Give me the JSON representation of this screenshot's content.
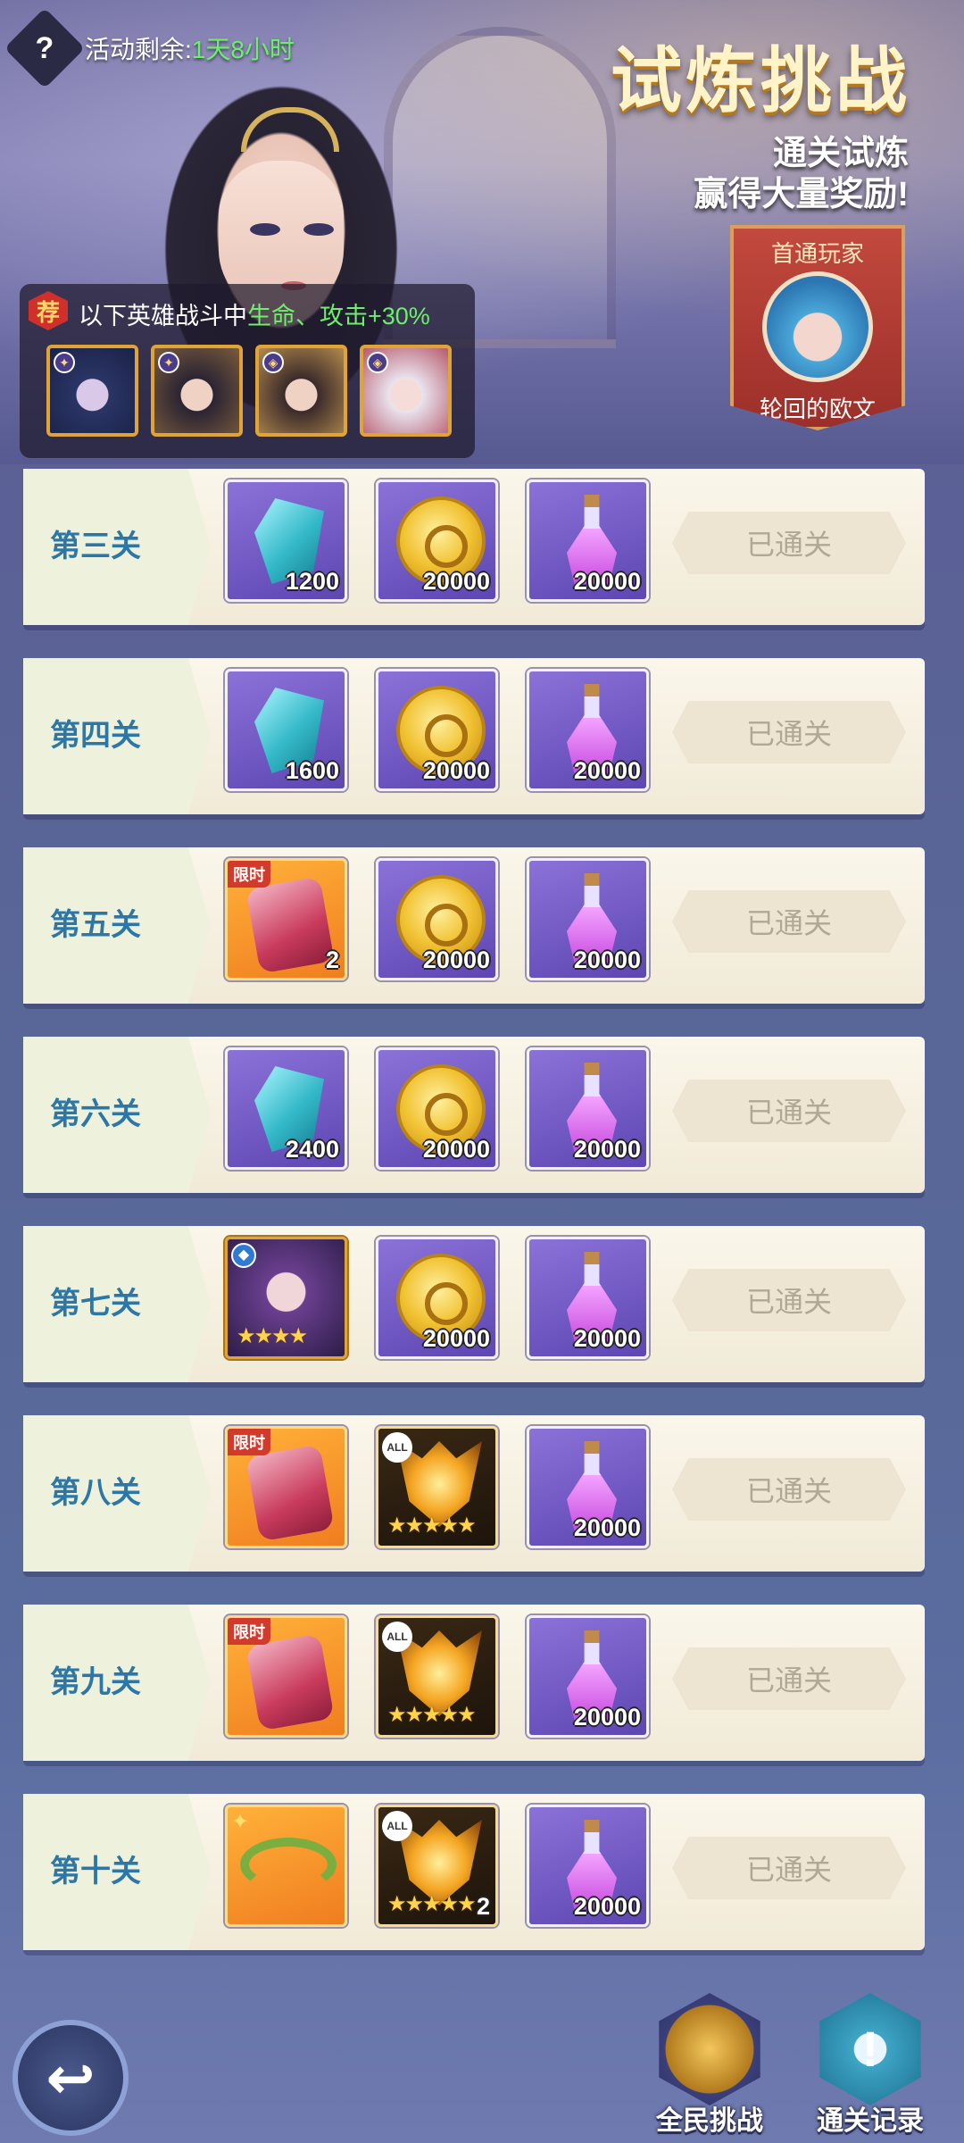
{
  "header": {
    "help_icon": "help-icon",
    "timer_label": "活动剩余:",
    "timer_value": "1天8小时",
    "title": "试炼挑战",
    "subtitle_line1": "通关试炼",
    "subtitle_line2": "赢得大量奖励!",
    "colors": {
      "title": "#fff3c8",
      "highlight": "#6cf06a"
    }
  },
  "first_clear": {
    "title": "首通玩家",
    "player_name": "轮回的欧文"
  },
  "bonus": {
    "tag": "荐",
    "text_prefix": "以下英雄战斗中",
    "text_highlight": "生命、攻击+30%",
    "heroes": [
      "hero-portrait-1",
      "hero-portrait-2",
      "hero-portrait-3",
      "hero-portrait-4"
    ]
  },
  "stages": [
    {
      "label": "第三关",
      "status": "已通关",
      "rewards": [
        {
          "type": "crystal",
          "qty": "1200"
        },
        {
          "type": "coin",
          "qty": "20000"
        },
        {
          "type": "potion",
          "qty": "20000"
        }
      ]
    },
    {
      "label": "第四关",
      "status": "已通关",
      "rewards": [
        {
          "type": "crystal",
          "qty": "1600"
        },
        {
          "type": "coin",
          "qty": "20000"
        },
        {
          "type": "potion",
          "qty": "20000"
        }
      ]
    },
    {
      "label": "第五关",
      "status": "已通关",
      "rewards": [
        {
          "type": "pack",
          "qty": "2",
          "badge": "限时"
        },
        {
          "type": "coin",
          "qty": "20000"
        },
        {
          "type": "potion",
          "qty": "20000"
        }
      ]
    },
    {
      "label": "第六关",
      "status": "已通关",
      "rewards": [
        {
          "type": "crystal",
          "qty": "2400"
        },
        {
          "type": "coin",
          "qty": "20000"
        },
        {
          "type": "potion",
          "qty": "20000"
        }
      ]
    },
    {
      "label": "第七关",
      "status": "已通关",
      "rewards": [
        {
          "type": "hero",
          "stars": "★★★★"
        },
        {
          "type": "coin",
          "qty": "20000"
        },
        {
          "type": "potion",
          "qty": "20000"
        }
      ]
    },
    {
      "label": "第八关",
      "status": "已通关",
      "rewards": [
        {
          "type": "pack",
          "badge": "限时"
        },
        {
          "type": "mask",
          "stars": "★★★★★",
          "badge": "ALL"
        },
        {
          "type": "potion",
          "qty": "20000"
        }
      ]
    },
    {
      "label": "第九关",
      "status": "已通关",
      "rewards": [
        {
          "type": "pack",
          "badge": "限时"
        },
        {
          "type": "mask",
          "stars": "★★★★★",
          "badge": "ALL"
        },
        {
          "type": "potion",
          "qty": "20000"
        }
      ]
    },
    {
      "label": "第十关",
      "status": "已通关",
      "rewards": [
        {
          "type": "wreath"
        },
        {
          "type": "mask",
          "stars": "★★★★★",
          "qty": "2",
          "badge": "ALL"
        },
        {
          "type": "potion",
          "qty": "20000"
        }
      ]
    }
  ],
  "footer": {
    "back_icon": "back-arrow-icon",
    "challenge_label": "全民挑战",
    "record_label": "通关记录",
    "record_icon_glyph": "!"
  }
}
